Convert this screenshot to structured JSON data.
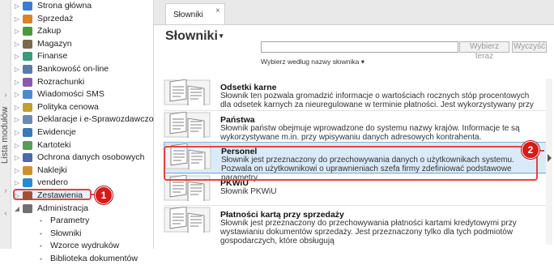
{
  "nav": {
    "vertical_label": "Lista modułów",
    "items": [
      {
        "label": "Strona główna",
        "icon": "home-icon",
        "color": "#3b7bd4"
      },
      {
        "label": "Sprzedaż",
        "icon": "sales-icon",
        "color": "#d9822b"
      },
      {
        "label": "Zakup",
        "icon": "cart-icon",
        "color": "#4a9a3b"
      },
      {
        "label": "Magazyn",
        "icon": "warehouse-icon",
        "color": "#7a6a4a"
      },
      {
        "label": "Finanse",
        "icon": "finance-icon",
        "color": "#3b9a7a"
      },
      {
        "label": "Bankowość on-line",
        "icon": "bank-icon",
        "color": "#5a7aa8"
      },
      {
        "label": "Rozrachunki",
        "icon": "settlements-icon",
        "color": "#8a5aa8"
      },
      {
        "label": "Wiadomości SMS",
        "icon": "sms-icon",
        "color": "#4a8ad4"
      },
      {
        "label": "Polityka cenowa",
        "icon": "pricing-icon",
        "color": "#c0a030"
      },
      {
        "label": "Deklaracje i e-Sprawozdawczość",
        "icon": "declarations-icon",
        "color": "#6a8ab0"
      },
      {
        "label": "Ewidencje",
        "icon": "records-icon",
        "color": "#3a7ab8"
      },
      {
        "label": "Kartoteki",
        "icon": "cards-icon",
        "color": "#5a9a5a"
      },
      {
        "label": "Ochrona danych osobowych",
        "icon": "privacy-icon",
        "color": "#4a6aa8"
      },
      {
        "label": "Naklejki",
        "icon": "stickers-icon",
        "color": "#d09030"
      },
      {
        "label": "vendero",
        "icon": "vendero-icon",
        "color": "#2a8ad0"
      },
      {
        "label": "Zestawienia",
        "icon": "reports-icon",
        "color": "#a0503a"
      },
      {
        "label": "Administracja",
        "icon": "admin-icon",
        "color": "#707070"
      }
    ],
    "subitems": [
      {
        "label": "Parametry"
      },
      {
        "label": "Słowniki"
      },
      {
        "label": "Wzorce wydruków"
      },
      {
        "label": "Biblioteka dokumentów"
      }
    ]
  },
  "annotations": {
    "badge1": "1",
    "badge2": "2",
    "accent": "#e2443f"
  },
  "tab": {
    "label": "Słowniki",
    "close": "×"
  },
  "page": {
    "title": "Słowniki",
    "title_caret": "▾"
  },
  "search": {
    "value": "",
    "choose_label": "Wybierz teraz",
    "clear_label": "Wyczyść"
  },
  "filter": {
    "label": "Wybierz według nazwy słownika ▾"
  },
  "dictionaries": [
    {
      "name": "Odsetki karne",
      "desc": "Słownik ten pozwala gromadzić informacje o wartościach rocznych stóp procentowych dla odsetek karnych za nieuregulowane w terminie płatności. Jest wykorzystywany przy"
    },
    {
      "name": "Państwa",
      "desc": "Słownik państw obejmuje wprowadzone do systemu nazwy krajów. Informacje te są wykorzystywane m.in. przy wpisywaniu danych adresowych kontrahenta."
    },
    {
      "name": "Personel",
      "desc": "Słownik jest przeznaczony do przechowywania danych o użytkownikach systemu. Pozwala on użytkownikowi o uprawnieniach szefa firmy zdefiniować podstawowe parametry"
    },
    {
      "name": "PKWiU",
      "desc": "Słownik PKWiU"
    },
    {
      "name": "Płatności kartą przy sprzedaży",
      "desc": "Słownik jest przeznaczony do przechowywania płatności kartami kredytowymi przy wystawianiu dokumentów sprzedaży. Jest przeznaczony tylko dla tych podmiotów gospodarczych, które obsługują"
    }
  ]
}
